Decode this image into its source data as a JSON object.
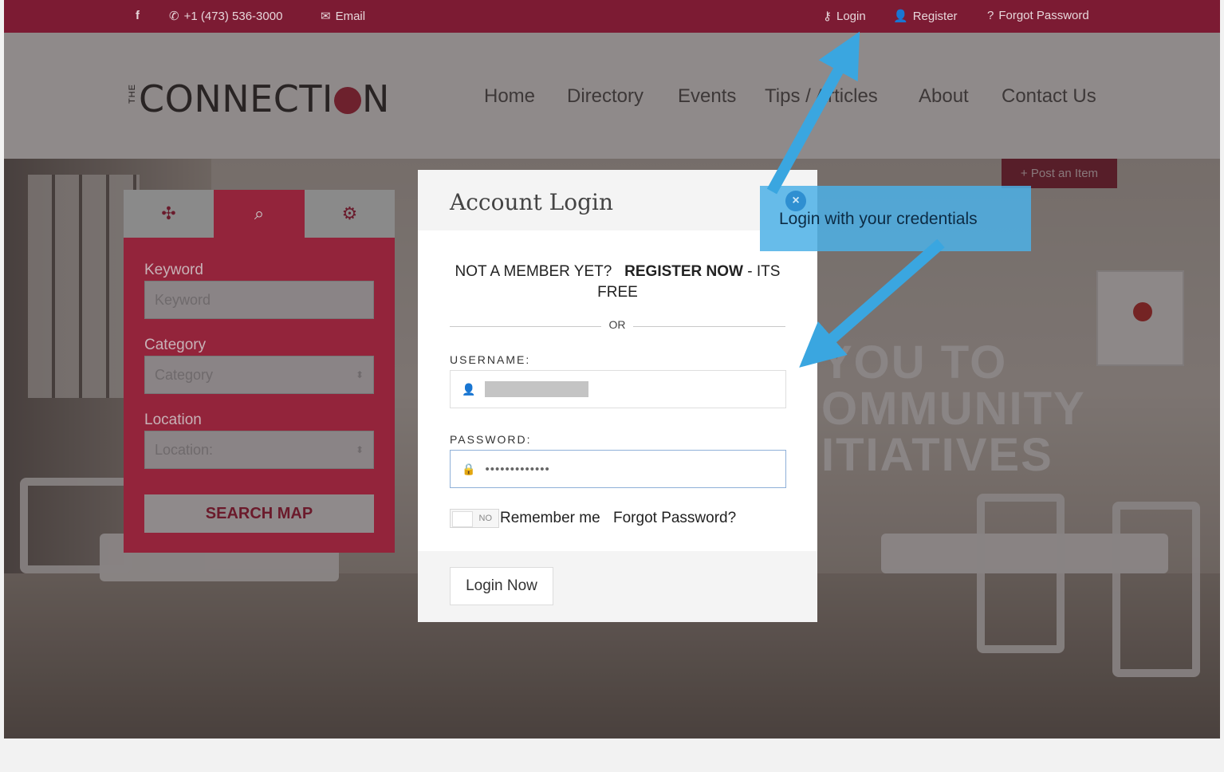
{
  "topbar": {
    "facebook_icon": "facebook-icon",
    "phone": "+1 (473) 536-3000",
    "email_label": "Email",
    "login": "Login",
    "register": "Register",
    "forgot": "Forgot Password"
  },
  "brand": {
    "the": "THE",
    "name_before": "CONNECTI",
    "name_after": "N"
  },
  "nav": [
    {
      "label": "Home"
    },
    {
      "label": "Directory"
    },
    {
      "label": "Events"
    },
    {
      "label": "Tips / Articles"
    },
    {
      "label": "About"
    },
    {
      "label": "Contact Us"
    }
  ],
  "hero": {
    "post_item": "+ Post an Item",
    "headline_lines": [
      "YOU TO",
      "OMMUNITY",
      "ITIATIVES"
    ]
  },
  "search_panel": {
    "tabs": [
      {
        "icon": "move-icon",
        "glyph": "✣"
      },
      {
        "icon": "zoom-icon",
        "glyph": "⌕"
      },
      {
        "icon": "gears-icon",
        "glyph": "⚙"
      }
    ],
    "keyword_label": "Keyword",
    "keyword_placeholder": "Keyword",
    "category_label": "Category",
    "category_value": "Category",
    "location_label": "Location",
    "location_value": "Location:",
    "search_button": "SEARCH MAP"
  },
  "modal": {
    "title": "Account Login",
    "not_member": "NOT A MEMBER YET?",
    "register_now": "REGISTER NOW",
    "its_free": " - ITS FREE",
    "or": "OR",
    "username_label": "USERNAME:",
    "password_label": "PASSWORD:",
    "password_value": "•••••••••••••",
    "toggle": "NO",
    "remember": "Remember me",
    "forgot": "Forgot Password?",
    "login_button": "Login Now"
  },
  "callout": {
    "text": "Login with your credentials"
  },
  "colors": {
    "brand": "#7c1b33",
    "panel": "#93243b",
    "callout": "#4cb0e6",
    "arrow": "#3aa6e0"
  }
}
